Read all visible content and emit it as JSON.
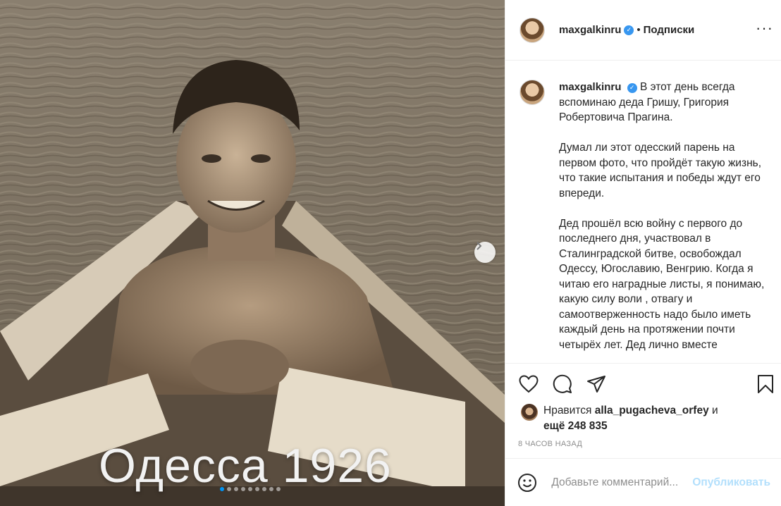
{
  "photo": {
    "caption_text": "Одесса 1926",
    "slide_count": 9,
    "active_slide": 1,
    "next_icon": "chevron-right-icon"
  },
  "header": {
    "username": "maxgalkinru",
    "separator": "•",
    "follow_status": "Подписки",
    "verified_icon": "verified-badge-icon",
    "more_icon": "more-dots-icon"
  },
  "caption": {
    "username": "maxgalkinru",
    "paragraphs": [
      "В этот день всегда вспоминаю деда Гришу, Григория Робертовича Прагина.",
      "Думал ли этот одесский парень на первом фото, что пройдёт такую жизнь, что такие испытания и победы ждут его впереди.",
      "Дед прошёл всю войну с первого до последнего дня, участвовал в Сталинградской битве, освобождал Одессу, Югославию, Венгрию. Когда я читаю его наградные листы, я понимаю, какую силу воли , отвагу и самоотверженность надо было иметь каждый день на протяжении почти четырёх лет. Дед лично вместе"
    ]
  },
  "actions": {
    "icons": [
      "heart-icon",
      "comment-icon",
      "share-icon",
      "bookmark-icon"
    ]
  },
  "likes": {
    "prefix": "Нравится",
    "user": "alla_pugacheva_orfey",
    "conjunction": "и",
    "more": "ещё 248 835"
  },
  "timestamp": "8 ЧАСОВ НАЗАД",
  "comment_bar": {
    "placeholder": "Добавьте комментарий...",
    "publish_label": "Опубликовать",
    "emoji_icon": "smiley-icon"
  },
  "colors": {
    "link_blue": "#0095f6",
    "publish_disabled": "#b2dffc",
    "verified_blue": "#3897f0",
    "sepia_dark": "#4a3f33",
    "sepia_light": "#c9bba5"
  }
}
